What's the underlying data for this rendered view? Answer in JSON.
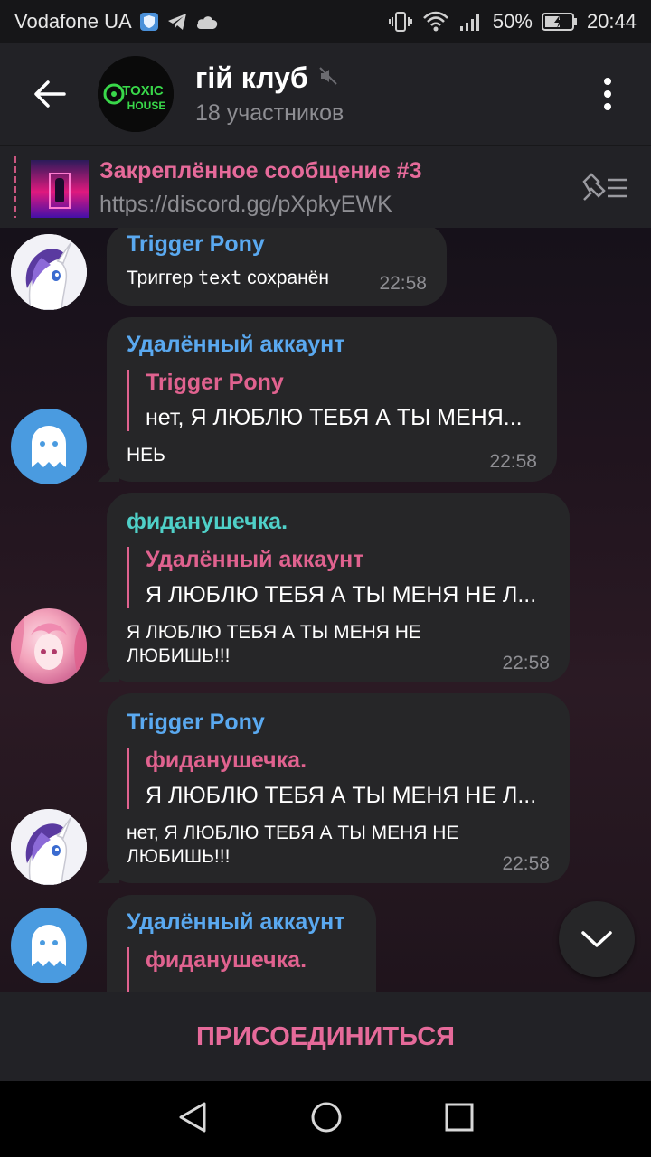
{
  "status_bar": {
    "carrier": "Vodafone UA",
    "battery": "50%",
    "time": "20:44"
  },
  "header": {
    "chat_title": "гій клуб",
    "subtitle": "18 участников",
    "avatar_text_line1": "TOXIC",
    "avatar_text_line2": "HOUSE"
  },
  "pinned": {
    "title": "Закреплённое сообщение #3",
    "link": "https://discord.gg/pXpkyEWK"
  },
  "messages": [
    {
      "sender": "Trigger Pony",
      "sender_color": "#5aa9f0",
      "text_prefix": "Триггер ",
      "text_code": "text",
      "text_suffix": " сохранён",
      "time": "22:58"
    },
    {
      "sender": "Удалённый аккаунт",
      "sender_color": "#5aa9f0",
      "reply_name": "Trigger Pony",
      "reply_text": "нет, Я ЛЮБЛЮ ТЕБЯ А ТЫ МЕНЯ...",
      "text": "НЕЬ",
      "time": "22:58"
    },
    {
      "sender": "фиданушечка.",
      "sender_color": "#4fd0c8",
      "reply_name": "Удалённый аккаунт",
      "reply_text": "Я ЛЮБЛЮ ТЕБЯ А ТЫ МЕНЯ НЕ Л...",
      "text_line1": "Я ЛЮБЛЮ ТЕБЯ А ТЫ МЕНЯ НЕ",
      "text_line2": "ЛЮБИШЬ!!!",
      "time": "22:58"
    },
    {
      "sender": "Trigger Pony",
      "sender_color": "#5aa9f0",
      "reply_name": "фиданушечка.",
      "reply_text": "Я ЛЮБЛЮ ТЕБЯ А ТЫ МЕНЯ НЕ Л...",
      "text_line1": "нет, Я ЛЮБЛЮ ТЕБЯ А ТЫ МЕНЯ НЕ",
      "text_line2": "ЛЮБИШЬ!!!",
      "time": "22:58"
    },
    {
      "sender": "Удалённый аккаунт",
      "sender_color": "#5aa9f0",
      "reply_name": "фиданушечка."
    }
  ],
  "join_button": "ПРИСОЕДИНИТЬСЯ",
  "colors": {
    "accent_pink": "#e66a9a",
    "link_blue": "#5aa9f0",
    "teal": "#4fd0c8"
  }
}
